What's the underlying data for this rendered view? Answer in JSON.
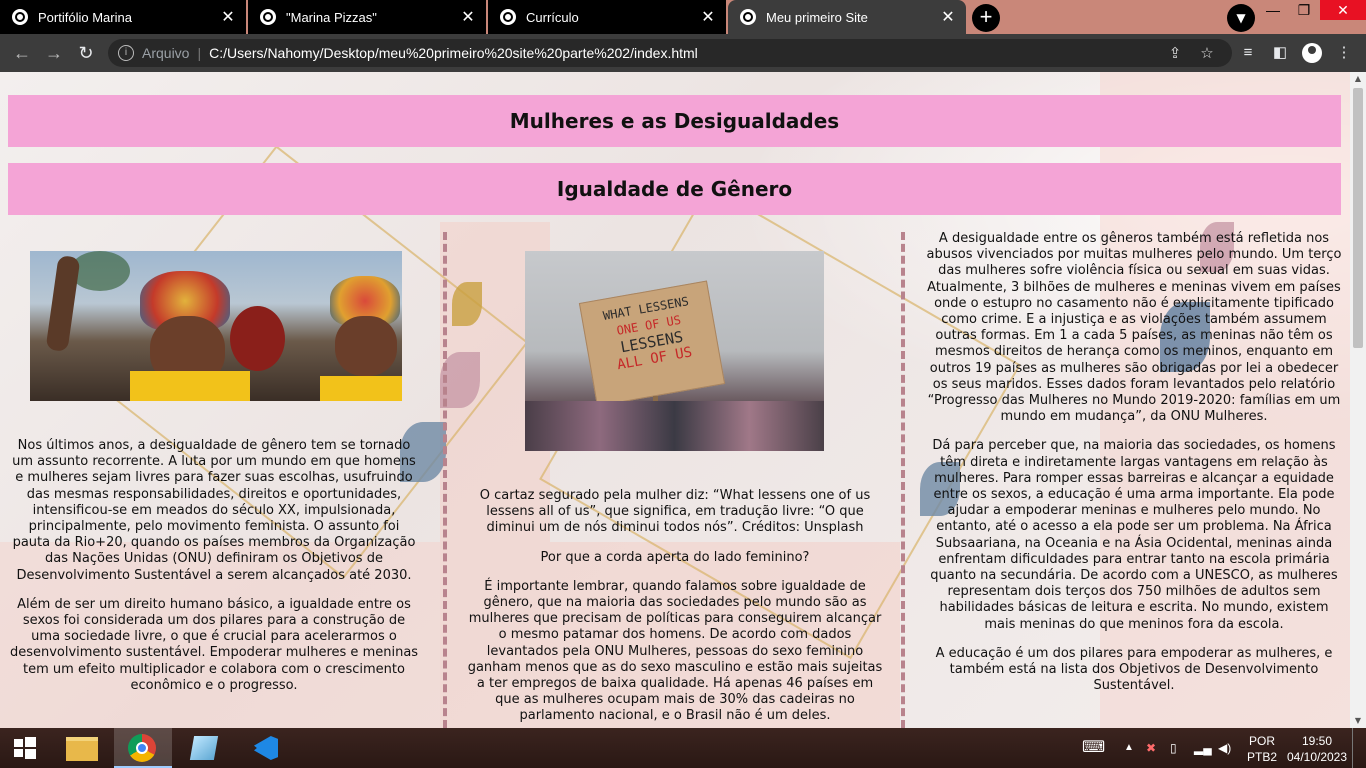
{
  "browser": {
    "tabs": [
      {
        "title": "Portifólio Marina",
        "active": false
      },
      {
        "title": "\"Marina Pizzas\"",
        "active": false
      },
      {
        "title": "Currículo",
        "active": false
      },
      {
        "title": "Meu primeiro Site",
        "active": true
      }
    ],
    "close_glyph": "✕",
    "new_tab_glyph": "+",
    "address": {
      "security_label": "Arquivo",
      "separator": "|",
      "url": "C:/Users/Nahomy/Desktop/meu%20primeiro%20site%20parte%202/index.html"
    },
    "icons": [
      "back-icon",
      "forward-icon",
      "reload-icon",
      "info-icon",
      "share-icon",
      "bookmark-star-icon",
      "reading-list-icon",
      "side-panel-icon",
      "profile-icon",
      "menu-icon"
    ]
  },
  "page": {
    "title": "Mulheres e as Desigualdades",
    "subtitle": "Igualdade de Gênero",
    "columns": [
      {
        "image_alt": "Mulheres com turbantes coloridos, uma delas com o punho erguido",
        "paragraphs": [
          "Nos últimos anos, a desigualdade de gênero tem se tornado um assunto recorrente. A luta por um mundo em que homens e mulheres sejam livres para fazer suas escolhas, usufruindo das mesmas responsabilidades, direitos e oportunidades, intensificou-se em meados do século XX, impulsionada, principalmente, pelo movimento feminista. O assunto foi pauta da Rio+20, quando os países membros da Organização das Nações Unidas (ONU) definiram os Objetivos de Desenvolvimento Sustentável a serem alcançados até 2030.",
          "Além de ser um direito humano básico, a igualdade entre os sexos foi considerada um dos pilares para a construção de uma sociedade livre, o que é crucial para acelerarmos o desenvolvimento sustentável. Empoderar mulheres e meninas tem um efeito multiplicador e colabora com o crescimento econômico e o progresso."
        ]
      },
      {
        "image_alt": "Mulher segurando cartaz em protesto",
        "sign_lines": [
          "WHAT LESSENS",
          "ONE OF US",
          "LESSENS",
          "ALL OF US"
        ],
        "paragraphs": [
          "O cartaz segurado pela mulher diz: “What lessens one of us lessens all of us”, que significa, em tradução livre: “O que diminui um de nós diminui todos nós”. Créditos: Unsplash",
          "Por que a corda aperta do lado feminino?",
          "É importante lembrar, quando falamos sobre igualdade de gênero, que na maioria das sociedades pelo mundo são as mulheres que precisam de políticas para conseguirem alcançar o mesmo patamar dos homens. De acordo com dados levantados pela ONU Mulheres, pessoas do sexo feminino ganham menos que as do sexo masculino e estão mais sujeitas a ter empregos de baixa qualidade. Há apenas 46 países em que as mulheres ocupam mais de 30% das cadeiras no parlamento nacional, e o Brasil não é um deles."
        ]
      },
      {
        "paragraphs": [
          "A desigualdade entre os gêneros também está refletida nos abusos vivenciados por muitas mulheres pelo mundo. Um terço das mulheres sofre violência física ou sexual em suas vidas. Atualmente, 3 bilhões de mulheres e meninas vivem em países onde o estupro no casamento não é explicitamente tipificado como crime. E a injustiça e as violações também assumem outras formas. Em 1 a cada 5 países, as meninas não têm os mesmos direitos de herança como os meninos, enquanto em outros 19 países as mulheres são obrigadas por lei a obedecer os seus maridos. Esses dados foram levantados pelo relatório “Progresso das Mulheres no Mundo 2019-2020: famílias em um mundo em mudança”, da ONU Mulheres.",
          "Dá para perceber que, na maioria das sociedades, os homens têm direta e indiretamente largas vantagens em relação às mulheres. Para romper essas barreiras e alcançar a equidade entre os sexos, a educação é uma arma importante. Ela pode ajudar a empoderar meninas e mulheres pelo mundo. No entanto, até o acesso a ela pode ser um problema. Na África Subsaariana, na Oceania e na Ásia Ocidental, meninas ainda enfrentam dificuldades para entrar tanto na escola primária quanto na secundária. De acordo com a UNESCO, as mulheres representam dois terços dos 750 milhões de adultos sem habilidades básicas de leitura e escrita. No mundo, existem mais meninas do que meninos fora da escola.",
          "A educação é um dos pilares para empoderar as mulheres, e também está na lista dos Objetivos de Desenvolvimento Sustentável."
        ]
      }
    ]
  },
  "taskbar": {
    "apps": [
      "windows-start-icon",
      "file-explorer-icon",
      "chrome-icon",
      "notes-app-icon",
      "vscode-icon"
    ],
    "language": "POR",
    "keyboard_layout": "PTB2",
    "time": "19:50",
    "date": "04/10/2023",
    "tray_icons": [
      "keyboard-icon",
      "chevron-up-icon",
      "network-error-icon",
      "battery-icon",
      "signal-icon",
      "volume-icon",
      "notification-icon"
    ]
  },
  "colors": {
    "banner": "#f4a4d6",
    "divider": "#b8838d",
    "tabstrip": "#c98779",
    "toolbar": "#3c3c3c"
  }
}
